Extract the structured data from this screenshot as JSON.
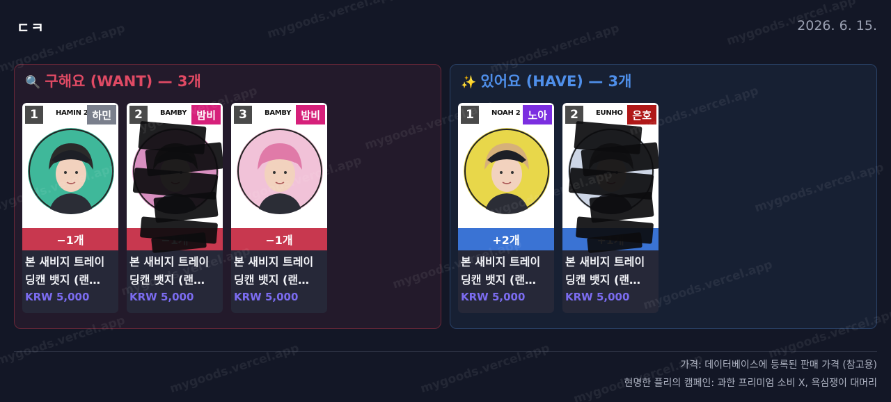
{
  "header": {
    "logo": "ㄷㅋ",
    "date": "2026. 6. 15."
  },
  "watermark": "mygoods.vercel.app",
  "want": {
    "emoji": "🔍",
    "title": "구해요 (WANT) — 3개",
    "accent": "#e04a64",
    "items": [
      {
        "rank": "1",
        "code": "HAMIN 2",
        "member": "하민",
        "tag_color": "#7a7f8c",
        "qty": "−1개",
        "name": "본 새비지 트레이\n딩캔 뱃지 (랜…",
        "price": "KRW 5,000",
        "redacted": false
      },
      {
        "rank": "2",
        "code": "BAMBY",
        "member": "밤비",
        "tag_color": "#d6207a",
        "qty": "−1개",
        "name": "본 새비지 트레이\n딩캔 뱃지 (랜…",
        "price": "KRW 5,000",
        "redacted": true
      },
      {
        "rank": "3",
        "code": "BAMBY",
        "member": "밤비",
        "tag_color": "#d6207a",
        "qty": "−1개",
        "name": "본 새비지 트레이\n딩캔 뱃지 (랜…",
        "price": "KRW 5,000",
        "redacted": false
      }
    ]
  },
  "have": {
    "emoji": "✨",
    "title": "있어요 (HAVE) — 3개",
    "accent": "#4f8fea",
    "items": [
      {
        "rank": "1",
        "code": "NOAH 2",
        "member": "노아",
        "tag_color": "#7b2ee0",
        "qty": "+2개",
        "name": "본 새비지 트레이\n딩캔 뱃지 (랜…",
        "price": "KRW 5,000",
        "redacted": false
      },
      {
        "rank": "2",
        "code": "EUNHO",
        "member": "은호",
        "tag_color": "#b01818",
        "qty": "+1개",
        "name": "본 새비지 트레이\n딩캔 뱃지 (랜…",
        "price": "KRW 5,000",
        "redacted": true
      }
    ]
  },
  "footer": {
    "line1": "가격: 데이터베이스에 등록된 판매 가격 (참고용)",
    "line2": "현명한 플리의 캠페인: 과한 프리미엄 소비 X, 욕심쟁이 대머리"
  }
}
